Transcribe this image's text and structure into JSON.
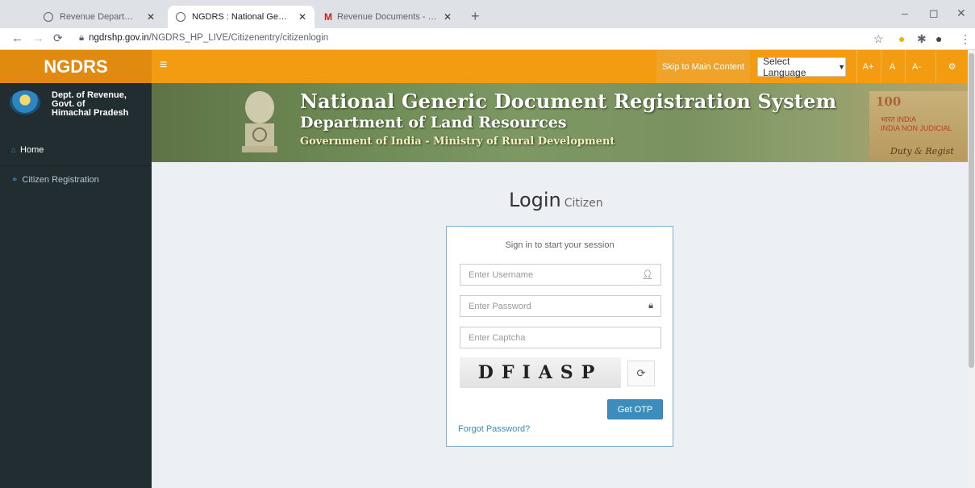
{
  "browser": {
    "tabs": [
      {
        "title": "Revenue Department, Governme",
        "active": false,
        "icon": "globe-icon"
      },
      {
        "title": "NGDRS : National Generic Docu",
        "active": true,
        "icon": "globe-icon"
      },
      {
        "title": "Revenue Documents - kanavkap",
        "active": false,
        "icon": "gmail-icon"
      }
    ],
    "new_tab_label": "+",
    "url_host": "ngdrshp.gov.in",
    "url_path": "/NGDRS_HP_LIVE/Citizenentry/citizenlogin"
  },
  "header": {
    "brand": "NGDRS",
    "menu_icon": "≡",
    "skip_link": "Skip to Main Content",
    "language_select": "Select Language",
    "font_buttons": [
      "A+",
      "A",
      "A-"
    ],
    "settings_icon": "gears-icon",
    "accent_color": "#f39c12",
    "brand_color": "#e08a10"
  },
  "sidebar": {
    "dept_lines": [
      "Dept. of Revenue,",
      "Govt. of",
      "Himachal Pradesh"
    ],
    "items": [
      {
        "label": "Home",
        "icon": "home-icon"
      },
      {
        "label": "Citizen Registration",
        "icon": "link-icon"
      }
    ],
    "background": "#222d32"
  },
  "banner": {
    "title": "National Generic Document Registration System",
    "subtitle": "Department of Land Resources",
    "ministry": "Government of India - Ministry of Rural Development",
    "stamp_value": "100",
    "stamp_text": "भारत INDIA\nINDIA NON JUDICIAL",
    "stamp_caption": "Duty & Regist"
  },
  "login": {
    "title": "Login",
    "title_small": "Citizen",
    "message": "Sign in to start your session",
    "username_placeholder": "Enter Username",
    "password_placeholder": "Enter Password",
    "captcha_placeholder": "Enter Captcha",
    "captcha_text": "DFIASP",
    "get_otp_label": "Get OTP",
    "forgot_label": "Forgot Password?",
    "button_color": "#3c8dbc"
  }
}
